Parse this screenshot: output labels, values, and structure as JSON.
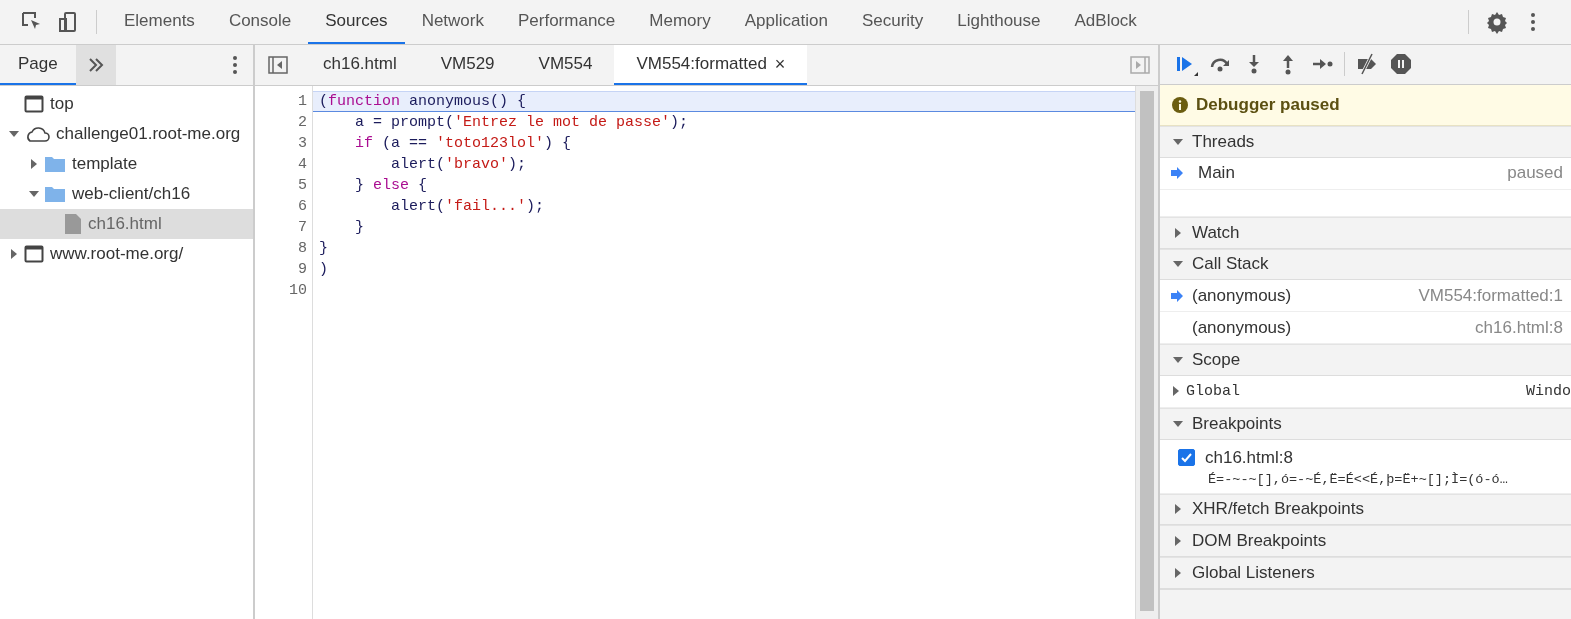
{
  "main_tabs": [
    {
      "label": "Elements",
      "selected": false
    },
    {
      "label": "Console",
      "selected": false
    },
    {
      "label": "Sources",
      "selected": true
    },
    {
      "label": "Network",
      "selected": false
    },
    {
      "label": "Performance",
      "selected": false
    },
    {
      "label": "Memory",
      "selected": false
    },
    {
      "label": "Application",
      "selected": false
    },
    {
      "label": "Security",
      "selected": false
    },
    {
      "label": "Lighthouse",
      "selected": false
    },
    {
      "label": "AdBlock",
      "selected": false
    }
  ],
  "navigator": {
    "tabs": [
      {
        "label": "Page",
        "selected": true
      }
    ],
    "tree": [
      {
        "kind": "frame",
        "label": "top"
      },
      {
        "kind": "cloud",
        "label": "challenge01.root-me.org",
        "expanded": true,
        "children": [
          {
            "kind": "folder",
            "label": "template",
            "expanded": false
          },
          {
            "kind": "folder",
            "label": "web-client/ch16",
            "expanded": true,
            "children": [
              {
                "kind": "file",
                "label": "ch16.html",
                "selected": true
              }
            ]
          }
        ]
      },
      {
        "kind": "frame",
        "label": "www.root-me.org/",
        "expanded": false
      }
    ]
  },
  "editor": {
    "tabs": [
      {
        "label": "ch16.html",
        "selected": false
      },
      {
        "label": "VM529",
        "selected": false
      },
      {
        "label": "VM554",
        "selected": false
      },
      {
        "label": "VM554:formatted",
        "selected": true,
        "close": "×"
      }
    ],
    "lines": [
      {
        "number": "1",
        "current": true,
        "tokens": [
          {
            "kind": "plain",
            "text": "("
          },
          {
            "kind": "keyword",
            "text": "function"
          },
          {
            "kind": "plain",
            "text": " anonymous() {"
          }
        ]
      },
      {
        "number": "2",
        "current": false,
        "tokens": [
          {
            "kind": "plain",
            "text": "    a = prompt("
          },
          {
            "kind": "string",
            "text": "'Entrez le mot de passe'"
          },
          {
            "kind": "plain",
            "text": ");"
          }
        ]
      },
      {
        "number": "3",
        "current": false,
        "tokens": [
          {
            "kind": "keyword",
            "text": "    if"
          },
          {
            "kind": "plain",
            "text": " (a == "
          },
          {
            "kind": "string",
            "text": "'toto123lol'"
          },
          {
            "kind": "plain",
            "text": ") {"
          }
        ]
      },
      {
        "number": "4",
        "current": false,
        "tokens": [
          {
            "kind": "plain",
            "text": "        alert("
          },
          {
            "kind": "string",
            "text": "'bravo'"
          },
          {
            "kind": "plain",
            "text": ");"
          }
        ]
      },
      {
        "number": "5",
        "current": false,
        "tokens": [
          {
            "kind": "plain",
            "text": "    } "
          },
          {
            "kind": "keyword",
            "text": "else"
          },
          {
            "kind": "plain",
            "text": " {"
          }
        ]
      },
      {
        "number": "6",
        "current": false,
        "tokens": [
          {
            "kind": "plain",
            "text": "        alert("
          },
          {
            "kind": "string",
            "text": "'fail...'"
          },
          {
            "kind": "plain",
            "text": ");"
          }
        ]
      },
      {
        "number": "7",
        "current": false,
        "tokens": [
          {
            "kind": "plain",
            "text": "    }"
          }
        ]
      },
      {
        "number": "8",
        "current": false,
        "tokens": [
          {
            "kind": "plain",
            "text": "}"
          }
        ]
      },
      {
        "number": "9",
        "current": false,
        "tokens": [
          {
            "kind": "plain",
            "text": ")"
          }
        ]
      },
      {
        "number": "10",
        "current": false
      }
    ]
  },
  "debugger": {
    "banner": "Debugger paused",
    "sections": [
      {
        "kind": "threads",
        "title": "Threads",
        "expanded": true,
        "rows": [
          {
            "name": "Main",
            "status": "paused",
            "current": true
          }
        ]
      },
      {
        "title": "Watch",
        "expanded": false
      },
      {
        "kind": "callstack",
        "title": "Call Stack",
        "expanded": true,
        "rows": [
          {
            "name": "(anonymous)",
            "status": "VM554:formatted:1",
            "current": true
          },
          {
            "name": "(anonymous)",
            "status": "ch16.html:8",
            "current": false
          }
        ]
      },
      {
        "kind": "scope",
        "title": "Scope",
        "expanded": true,
        "rows": [
          {
            "name": "Global",
            "status": "Windo"
          }
        ]
      },
      {
        "kind": "breakpoints",
        "title": "Breakpoints",
        "expanded": true,
        "items": [
          {
            "label": "ch16.html:8",
            "checked": true,
            "code": "É=-~-~[],ó=-~É,Ë=É<<É,þ=Ë+~[];Ì=(ó-ó…"
          }
        ]
      },
      {
        "title": "XHR/fetch Breakpoints",
        "expanded": false
      },
      {
        "title": "DOM Breakpoints",
        "expanded": false
      },
      {
        "title": "Global Listeners",
        "expanded": false
      }
    ]
  }
}
